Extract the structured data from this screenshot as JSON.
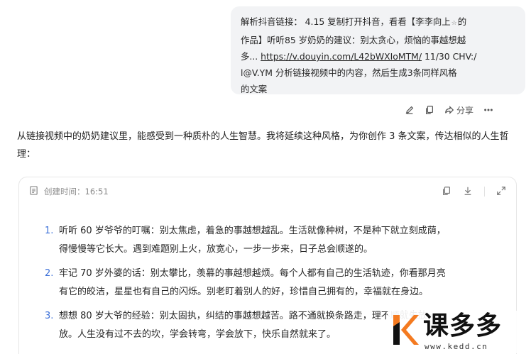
{
  "user_message": {
    "line1": "解析抖音链接： 4.15 复制打开抖音，看看【李李向上",
    "line1_tail": "的",
    "line2": "作品】听听85 岁奶奶的建议：别太贪心，烦恼的事越想越",
    "line3_pre": "多... ",
    "link": "https://v.douyin.com/L42bWXIoMTM/",
    "line3_post": " 11/30 CHV:/",
    "line4": "l@V.YM     分析链接视频中的内容，然后生成3条同样风格",
    "line5": "的文案"
  },
  "actions": {
    "share_label": "分享",
    "icons": [
      "edit-icon",
      "copy-icon",
      "share-icon",
      "more-icon"
    ]
  },
  "assistant_intro": "从链接视频中的奶奶建议里，能感受到一种质朴的人生智慧。我将延续这种风格，为你创作 3 条文案，传达相似的人生哲理：",
  "document": {
    "created_label": "创建时间：16:51",
    "items": [
      {
        "number": "1.",
        "line1": "听听 60 岁爷爷的叮嘱：别太焦虑，着急的事越想越乱。生活就像种树，不是种下就立刻成荫，",
        "line2": "得慢慢等它长大。遇到难题别上火，放宽心，一步一步来，日子总会顺遂的。"
      },
      {
        "number": "2.",
        "line1": "牢记 70 岁外婆的话：别太攀比，羡慕的事越想越烦。每个人都有自己的生活轨迹，你看那月亮",
        "line2": "有它的皎洁，星星也有自己的闪烁。别老盯着别人的好，珍惜自己拥有的，幸福就在身边。"
      },
      {
        "number": "3.",
        "line1": "想想 80 岁大爷的经验：别太固执，纠结的事越想越苦。路不通就换条路走，理不顺就先放一",
        "line2": "放。人生没有过不去的坎，学会转弯，学会放下，快乐自然就来了。"
      }
    ]
  },
  "watermark": {
    "title": "课多多",
    "url": "www.kedd.cn",
    "accent": "#f47a20"
  },
  "colors": {
    "bubble_bg": "#f2f3f5",
    "list_number": "#3b6fd8",
    "muted_text": "#8a8a8a"
  }
}
